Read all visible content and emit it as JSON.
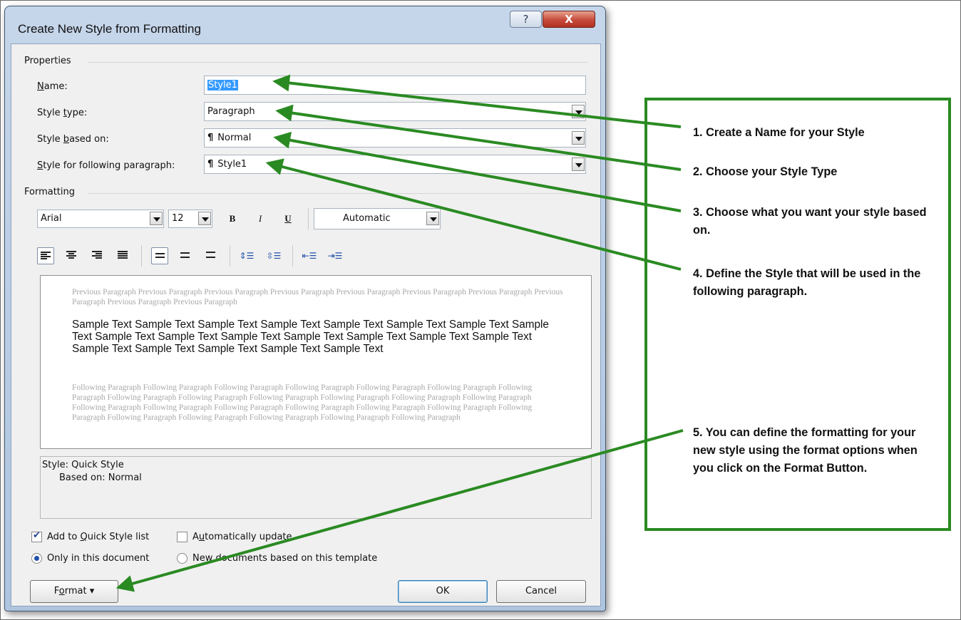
{
  "dialog": {
    "title": "Create New Style from Formatting",
    "help_icon": "?",
    "close_icon": "X"
  },
  "properties": {
    "section_label": "Properties",
    "name_label_u": "N",
    "name_label_rest": "ame:",
    "name_value": "Style1",
    "style_type_label_a": "Style ",
    "style_type_label_u": "t",
    "style_type_label_b": "ype:",
    "style_type_value": "Paragraph",
    "based_on_label_a": "Style ",
    "based_on_label_u": "b",
    "based_on_label_b": "ased on:",
    "based_on_value": "Normal",
    "following_label_a": "",
    "following_label_u": "S",
    "following_label_b": "tyle for following paragraph:",
    "following_value": "Style1",
    "paragraph_glyph": "¶"
  },
  "formatting": {
    "section_label": "Formatting",
    "font": "Arial",
    "size": "12",
    "bold": "B",
    "italic": "I",
    "underline": "U",
    "color": "Automatic"
  },
  "preview": {
    "previous_paragraph": "Previous Paragraph Previous Paragraph Previous Paragraph Previous Paragraph Previous Paragraph Previous Paragraph Previous Paragraph Previous Paragraph Previous Paragraph Previous Paragraph",
    "sample_text": "Sample Text Sample Text Sample Text Sample Text Sample Text Sample Text Sample Text Sample Text Sample Text Sample Text Sample Text Sample Text Sample Text Sample Text Sample Text Sample Text Sample Text Sample Text Sample Text Sample Text",
    "following_paragraph": "Following Paragraph Following Paragraph Following Paragraph Following Paragraph Following Paragraph Following Paragraph Following Paragraph Following Paragraph Following Paragraph Following Paragraph Following Paragraph Following Paragraph Following Paragraph Following Paragraph Following Paragraph Following Paragraph Following Paragraph Following Paragraph Following Paragraph Following Paragraph Following Paragraph Following Paragraph Following Paragraph Following Paragraph Following Paragraph"
  },
  "description": {
    "line1": "Style: Quick Style",
    "line2": "Based on: Normal"
  },
  "options": {
    "add_quick_style_a": "Add to ",
    "add_quick_style_u": "Q",
    "add_quick_style_b": "uick Style list",
    "add_quick_style_checked": true,
    "auto_update_a": "A",
    "auto_update_u": "u",
    "auto_update_b": "tomatically update",
    "auto_update_checked": false,
    "only_doc": "Only in this document",
    "new_docs": "New documents based on this template"
  },
  "buttons": {
    "format_u": "o",
    "format_a": "F",
    "format_b": "rmat",
    "format_arrow": "▾",
    "ok": "OK",
    "cancel": "Cancel"
  },
  "instructions": {
    "step1": "1.  Create a Name for your Style",
    "step2": "2. Choose your Style Type",
    "step3": "3. Choose what you want your style based on.",
    "step4": "4. Define the Style that will be used in the following paragraph.",
    "step5": "5. You can define the formatting for your new style using the format options when you click on the Format Button."
  },
  "colors": {
    "arrow": "#2a8a22",
    "callout_border": "#2a8a22",
    "selection": "#3399ff"
  }
}
